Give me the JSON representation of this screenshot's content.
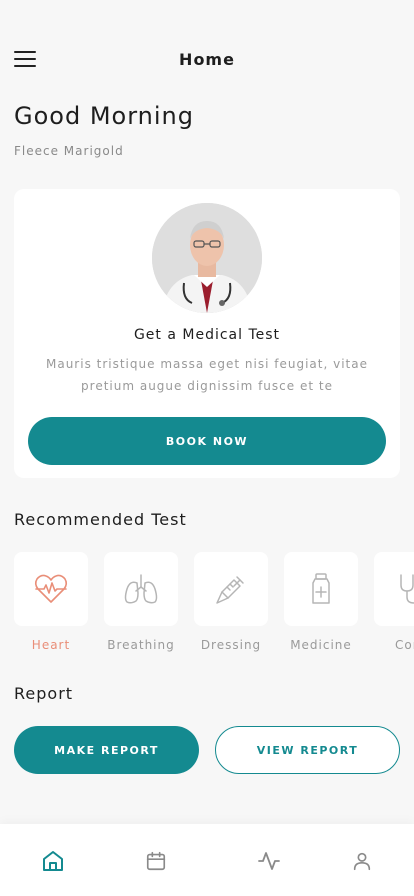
{
  "header": {
    "title": "Home"
  },
  "greeting": {
    "title": "Good Morning",
    "name": "Fleece Marigold"
  },
  "promo": {
    "title": "Get a Medical Test",
    "description": "Mauris tristique massa eget nisi feugiat, vitae pretium augue dignissim fusce et te",
    "button_label": "BOOK NOW"
  },
  "recommended": {
    "title": "Recommended Test",
    "items": [
      {
        "label": "Heart",
        "icon": "heart-pulse-icon",
        "active": true
      },
      {
        "label": "Breathing",
        "icon": "lungs-icon",
        "active": false
      },
      {
        "label": "Dressing",
        "icon": "syringe-icon",
        "active": false
      },
      {
        "label": "Medicine",
        "icon": "medicine-bottle-icon",
        "active": false
      },
      {
        "label": "Cont",
        "icon": "stethoscope-icon",
        "active": false
      }
    ]
  },
  "report": {
    "title": "Report",
    "make_label": "MAKE REPORT",
    "view_label": "VIEW REPORT"
  },
  "nav": {
    "items": [
      {
        "icon": "home-icon",
        "active": true
      },
      {
        "icon": "calendar-icon",
        "active": false
      },
      {
        "icon": "activity-icon",
        "active": false
      },
      {
        "icon": "user-icon",
        "active": false
      }
    ]
  },
  "colors": {
    "accent": "#148a90",
    "active_test": "#e98e78",
    "muted": "#9a9a9a"
  }
}
